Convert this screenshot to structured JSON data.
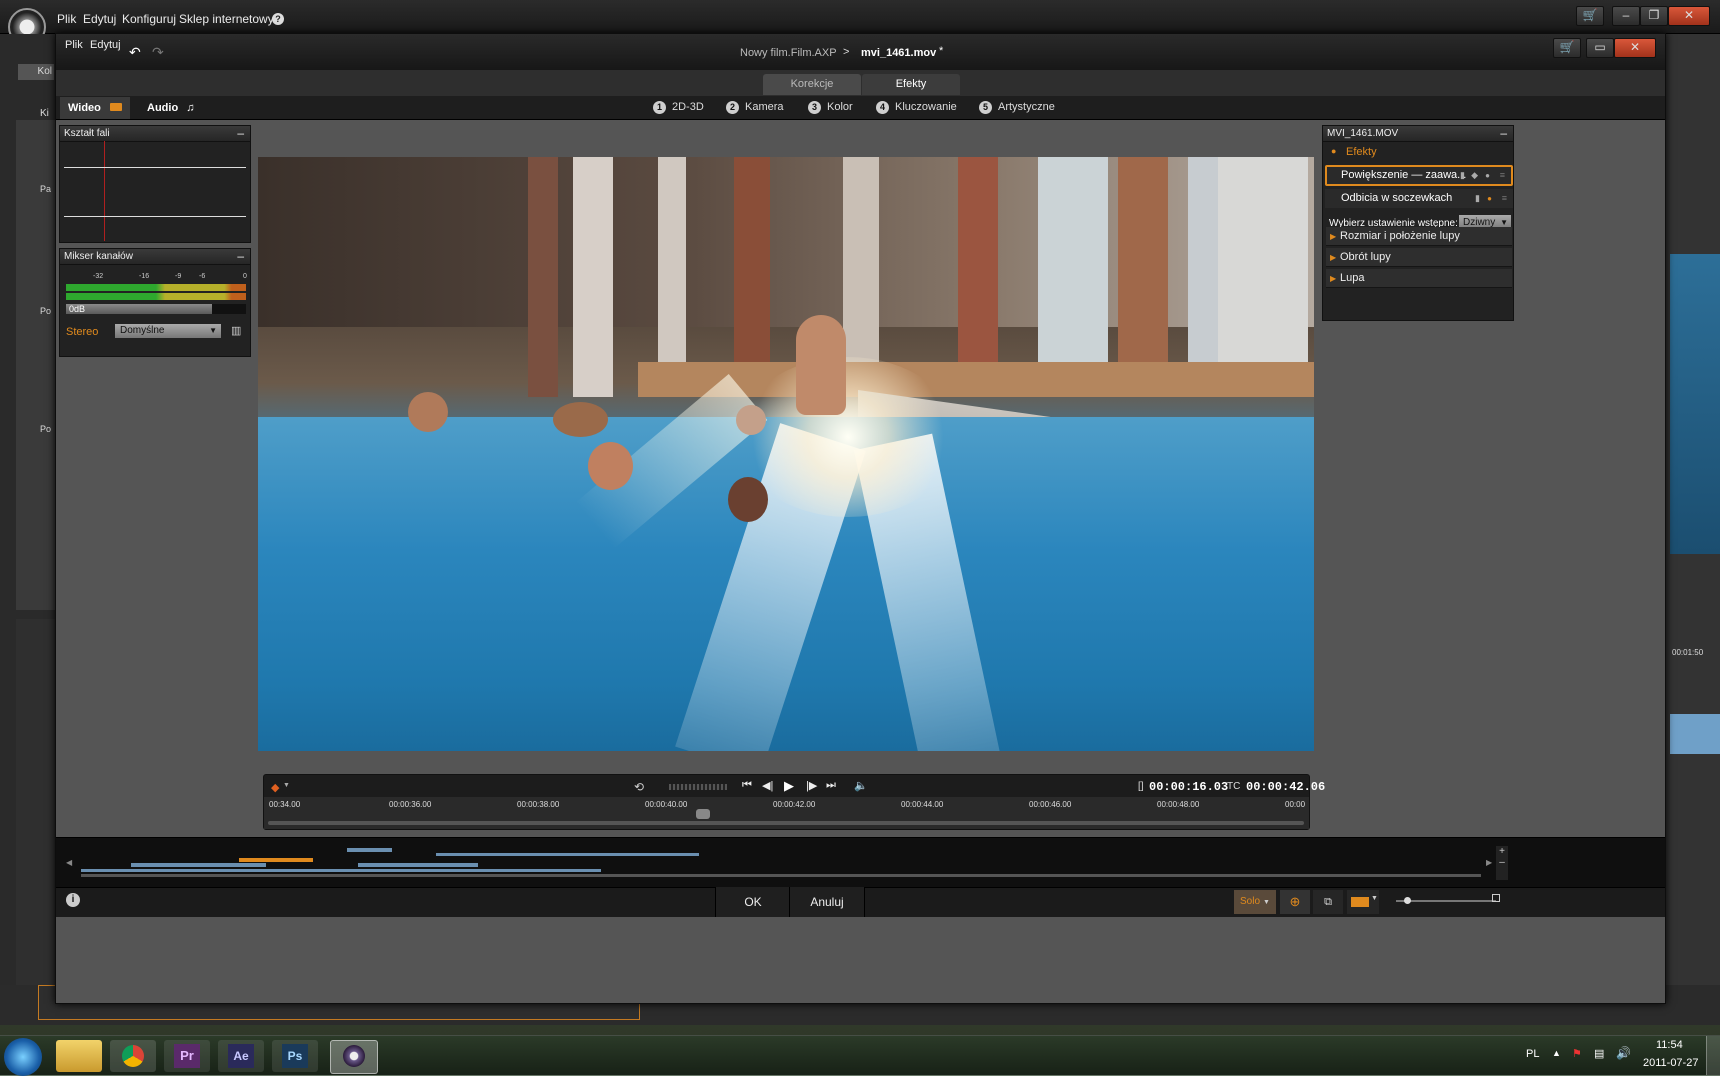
{
  "app": {
    "menu": [
      "Plik",
      "Edytuj",
      "Konfiguruj",
      "Sklep internetowy"
    ],
    "help_icon": "?",
    "outer_left_tab": "Kol",
    "outer_left_labels": [
      "Ki",
      "Pa",
      "Po",
      "Po"
    ]
  },
  "dialog": {
    "menu": [
      "Plik",
      "Edytuj"
    ],
    "title_project": "Nowy film.Film.AXP",
    "title_sep": ">",
    "title_clip": "mvi_1461.mov",
    "title_mark": "*",
    "top_tabs": [
      {
        "label": "Korekcje",
        "active": false
      },
      {
        "label": "Efekty",
        "active": true
      }
    ],
    "media_tabs": [
      {
        "label": "Wideo",
        "active": true
      },
      {
        "label": "Audio",
        "active": false
      }
    ],
    "steps": [
      {
        "num": "1",
        "label": "2D-3D"
      },
      {
        "num": "2",
        "label": "Kamera"
      },
      {
        "num": "3",
        "label": "Kolor"
      },
      {
        "num": "4",
        "label": "Kluczowanie"
      },
      {
        "num": "5",
        "label": "Artystyczne"
      }
    ]
  },
  "waveform_panel": {
    "title": "Kształt fali",
    "min": "–"
  },
  "mixer_panel": {
    "title": "Mikser kanałów",
    "min": "–",
    "scale": [
      "-32",
      "-16",
      "-9",
      "-6",
      "0"
    ],
    "gain": "0dB",
    "mode_label": "Stereo",
    "preset": "Domyślne"
  },
  "effects_panel": {
    "title": "MVI_1461.MOV",
    "min": "–",
    "section": "Efekty",
    "items": [
      "Powiększenie — zaawa...",
      "Odbicia w soczewkach"
    ],
    "preset_label": "Wybierz ustawienie wstępne:",
    "preset_value": "Dziwny",
    "groups": [
      "Rozmiar i położenie lupy",
      "Obrót lupy",
      "Lupa"
    ]
  },
  "transport": {
    "duration_icon": "[]",
    "duration": "00:00:16.03",
    "tc_label": "TC",
    "timecode": "00:00:42.06",
    "ruler": [
      "00:34.00",
      "00:00:36.00",
      "00:00:38.00",
      "00:00:40.00",
      "00:00:42.00",
      "00:00:44.00",
      "00:00:46.00",
      "00:00:48.00",
      "00:00"
    ],
    "playhead_fraction": 0.42
  },
  "bottom": {
    "info": "i",
    "ok": "OK",
    "cancel": "Anuluj",
    "solo": "Solo"
  },
  "outer_right": {
    "timecode": "00:01:50"
  },
  "taskbar": {
    "lang": "PL",
    "time": "11:54",
    "date": "2011-07-27",
    "apps": [
      "windows-start",
      "explorer",
      "chrome",
      "premiere",
      "after-effects",
      "photoshop",
      "pinnacle"
    ]
  },
  "colors": {
    "accent": "#e08a1e",
    "panel": "#222222",
    "dialog": "#555555"
  }
}
